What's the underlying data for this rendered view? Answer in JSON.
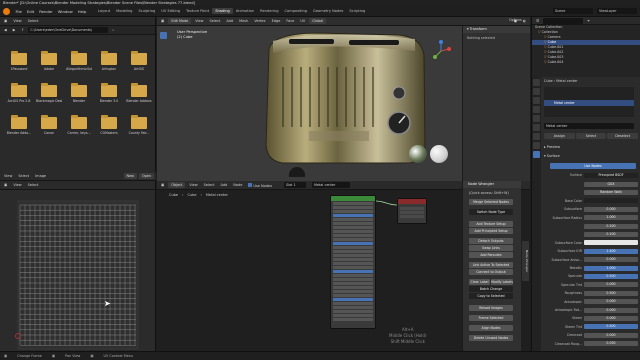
{
  "titlebar": {
    "text": "Blender* [D:\\Online Courses\\Blender Modeling Strategies\\Blender Scene Files\\Blender Strategies 77.blend]"
  },
  "menubar": {
    "items": [
      "File",
      "Edit",
      "Render",
      "Window",
      "Help"
    ],
    "workspaces": [
      "Layout",
      "Modeling",
      "Sculpting",
      "UV Editing",
      "Texture Paint",
      "Shading",
      "Animation",
      "Rendering",
      "Compositing",
      "Geometry Nodes",
      "Scripting"
    ],
    "active_workspace": "Shading",
    "scene_label": "Scene",
    "viewlayer_label": "ViewLayer"
  },
  "filebrowser": {
    "header": {
      "view": "View",
      "select": "Select"
    },
    "path": "C:\\Users\\eder\\OneDrive\\Documents\\",
    "folders": [
      {
        "name": "1Password"
      },
      {
        "name": "Adobe"
      },
      {
        "name": "AllegorithmicSubs"
      },
      {
        "name": "Arlington"
      },
      {
        "name": "ArtGIS"
      },
      {
        "name": "ArcGIS Pro 2.8"
      },
      {
        "name": "Blackmagic Design"
      },
      {
        "name": "Blender"
      },
      {
        "name": "Blender 3.0"
      },
      {
        "name": "Blender Addons"
      },
      {
        "name": "Blender Addo..."
      },
      {
        "name": "Canon"
      },
      {
        "name": "Carrier, keys..."
      },
      {
        "name": "CGMasters"
      },
      {
        "name": "County Fair..."
      }
    ],
    "footer": {
      "view": "View",
      "select": "Select",
      "image": "Image",
      "new": "New",
      "open": "Open"
    }
  },
  "uv_editor": {
    "header": {
      "view": "View",
      "select": "Select"
    }
  },
  "viewport": {
    "header": {
      "mode": "Edit Mode",
      "view": "View",
      "select": "Select",
      "add": "Add",
      "mesh": "Mesh",
      "vertex": "Vertex",
      "edge": "Edge",
      "face": "Face",
      "uv": "UV",
      "global": "Global"
    },
    "overlay_text": [
      "User Perspective",
      "(2) Cube"
    ],
    "n_panel": {
      "tab": "Transform",
      "message": "Nothing selected",
      "options": "Options"
    }
  },
  "node_editor": {
    "header": {
      "object": "Object",
      "view": "View",
      "select": "Select",
      "add": "Add",
      "node": "Node",
      "use_nodes": "Use Nodes",
      "slot": "Slot 1",
      "material": "Metal center"
    },
    "breadcrumb": [
      "Cube",
      "Cube",
      "Metal center"
    ],
    "node_wrangler": {
      "title": "Node Wrangler",
      "quick_access": "(Quick access: Shift+W)",
      "merge": "Merge Selected Nodes",
      "switch": "Switch Node Type",
      "add_texture": "Add Texture Setup",
      "add_principled": "Add Principled Setup",
      "detach": "Detach Outputs",
      "swap": "Swap Links",
      "add_reroutes": "Add Reroutes",
      "link_active": "Link Active To Selected",
      "connect_output": "Connect to Output",
      "clear_label": "Clear Label",
      "modify_labels": "Modify Labels",
      "batch_change": "Batch Change",
      "copy_selected": "Copy to Selected",
      "reload_images": "Reload Images",
      "frame_selected": "Frame Selected",
      "align_nodes": "Align Nodes",
      "delete_unused": "Delete Unused Nodes"
    },
    "overlay_hint": [
      "Alt+A",
      "Middle Click (Hold)",
      "Shift Middle Click"
    ]
  },
  "outliner": {
    "title": "Scene Collection",
    "items": [
      {
        "name": "Collection",
        "selected": false
      },
      {
        "name": "Camera",
        "selected": false
      },
      {
        "name": "Cube",
        "selected": true
      },
      {
        "name": "Cube.001",
        "selected": false
      },
      {
        "name": "Cube.002",
        "selected": false
      },
      {
        "name": "Cube.003",
        "selected": false
      },
      {
        "name": "Cube.004",
        "selected": false
      }
    ]
  },
  "properties": {
    "object": "Cube",
    "material_top": "Metal center",
    "slot_material": "Metal center",
    "material_field": "Metal center",
    "buttons": {
      "assign": "Assign",
      "select": "Select",
      "deselect": "Deselect"
    },
    "sections": {
      "preview": "Preview",
      "surface": "Surface",
      "use_nodes": "Use Nodes"
    },
    "surface_value": "Principled BSDF",
    "rows": [
      {
        "label": "",
        "value": "GGX",
        "style": "normal"
      },
      {
        "label": "",
        "value": "Random Walk",
        "style": "normal"
      },
      {
        "label": "Base Color",
        "value": "",
        "style": "dark"
      },
      {
        "label": "Subsurface",
        "value": "0.000",
        "style": "normal"
      },
      {
        "label": "Subsurface Radius",
        "value": "1.000",
        "style": "normal"
      },
      {
        "label": "",
        "value": "0.200",
        "style": "normal"
      },
      {
        "label": "",
        "value": "0.100",
        "style": "normal"
      },
      {
        "label": "Subsurface Color",
        "value": "",
        "style": "white"
      },
      {
        "label": "Subsurface IOR",
        "value": "1.400",
        "style": "blue"
      },
      {
        "label": "Subsurface Aniso...",
        "value": "0.000",
        "style": "normal"
      },
      {
        "label": "Metallic",
        "value": "1.000",
        "style": "blue"
      },
      {
        "label": "Specular",
        "value": "0.500",
        "style": "blue"
      },
      {
        "label": "Specular Tint",
        "value": "0.000",
        "style": "normal"
      },
      {
        "label": "Roughness",
        "value": "0.500",
        "style": "normal"
      },
      {
        "label": "Anisotropic",
        "value": "0.000",
        "style": "normal"
      },
      {
        "label": "Anisotropic Rot...",
        "value": "0.000",
        "style": "normal"
      },
      {
        "label": "Sheen",
        "value": "0.000",
        "style": "normal"
      },
      {
        "label": "Sheen Tint",
        "value": "0.500",
        "style": "blue"
      },
      {
        "label": "Clearcoat",
        "value": "0.000",
        "style": "normal"
      },
      {
        "label": "Clearcoat Roug...",
        "value": "0.030",
        "style": "normal"
      }
    ]
  },
  "statusbar": {
    "items": [
      "Change Frame",
      "Pan View",
      "UV Context Menu"
    ]
  },
  "colors": {
    "accent": "#4772b3",
    "selection": "#334d80",
    "folder": "#d7a84a"
  }
}
